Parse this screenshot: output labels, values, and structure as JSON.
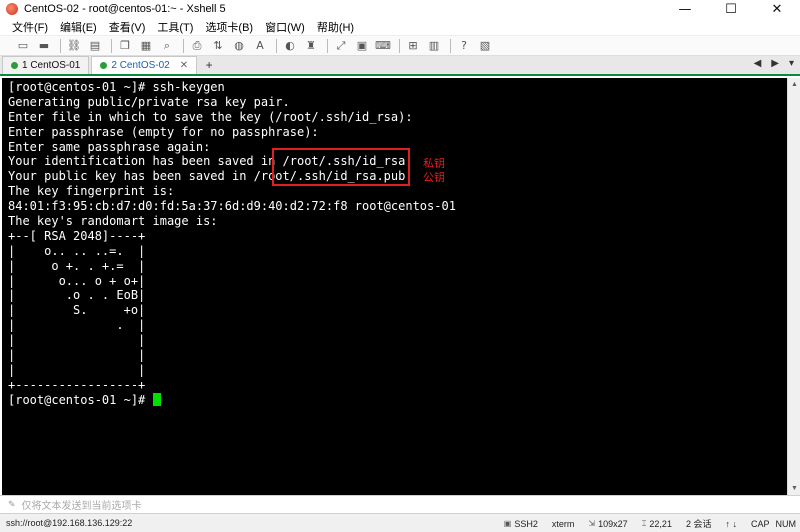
{
  "window": {
    "title": "CentOS-02 - root@centos-01:~ - Xshell 5",
    "controls": {
      "minimize": "—",
      "maximize": "☐",
      "close": "✕"
    }
  },
  "menu": [
    "文件(F)",
    "编辑(E)",
    "查看(V)",
    "工具(T)",
    "选项卡(B)",
    "窗口(W)",
    "帮助(H)"
  ],
  "toolbar_icons": [
    "new-session-icon",
    "open-folder-icon",
    "link-icon",
    "properties-icon",
    "copy-icon",
    "paste-icon",
    "find-icon",
    "print-icon",
    "transfer-icon",
    "globe-icon",
    "font-icon",
    "xftp-icon",
    "lock-icon",
    "fullscreen-icon",
    "window-icon",
    "keyboard-icon",
    "add-icon",
    "layout-icon",
    "help-icon",
    "layout2-icon"
  ],
  "tabs": [
    {
      "label": "1 CentOS-01",
      "active": false
    },
    {
      "label": "2 CentOS-02",
      "active": true
    }
  ],
  "tab_add": "+",
  "tab_nav": {
    "prev": "◀",
    "next": "▶",
    "menu": "▾"
  },
  "terminal": {
    "lines": [
      "[root@centos-01 ~]# ssh-keygen",
      "Generating public/private rsa key pair.",
      "Enter file in which to save the key (/root/.ssh/id_rsa):",
      "Enter passphrase (empty for no passphrase):",
      "Enter same passphrase again:",
      "Your identification has been saved in /root/.ssh/id_rsa.",
      "Your public key has been saved in /root/.ssh/id_rsa.pub.",
      "The key fingerprint is:",
      "84:01:f3:95:cb:d7:d0:fd:5a:37:6d:d9:40:d2:72:f8 root@centos-01",
      "The key's randomart image is:",
      "+--[ RSA 2048]----+",
      "|    o.. .. ..=.  |",
      "|     o +. . +.=  |",
      "|      o... o + o+|",
      "|       .o . . EoB|",
      "|        S.     +o|",
      "|              .  |",
      "|                 |",
      "|                 |",
      "|                 |",
      "+-----------------+"
    ],
    "prompt": "[root@centos-01 ~]# "
  },
  "annotations": {
    "private_key": "私钥",
    "public_key": "公钥"
  },
  "input_bar": {
    "placeholder": "仅将文本发送到当前选项卡"
  },
  "status": {
    "connection": "ssh://root@192.168.136.129:22",
    "protocol": "SSH2",
    "terminal": "xterm",
    "size": "109x27",
    "cursor_pos": "22,21",
    "sessions": "2 会话",
    "caps": "CAP",
    "num": "NUM"
  },
  "colors": {
    "terminal_bg": "#000000",
    "terminal_fg": "#ffffff",
    "cursor": "#00e000",
    "annotation": "#e02020",
    "tab_accent": "#0a8a3c"
  }
}
